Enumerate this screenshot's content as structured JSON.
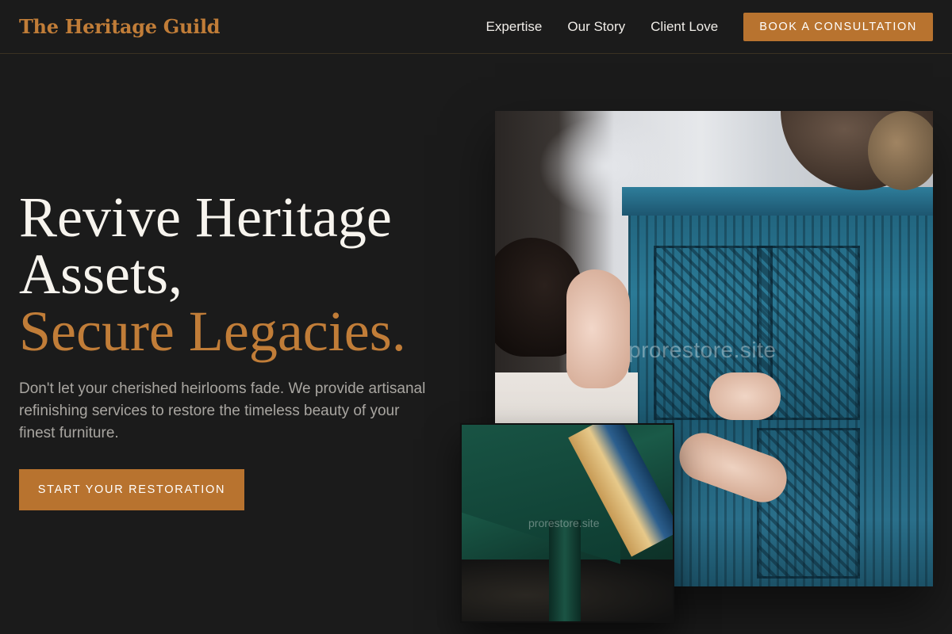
{
  "nav": {
    "brand": "The Heritage Guild",
    "links": [
      "Expertise",
      "Our Story",
      "Client Love"
    ],
    "cta": "BOOK A CONSULTATION"
  },
  "hero": {
    "title_line1": "Revive Heritage",
    "title_line2": "Assets,",
    "title_accent": "Secure Legacies.",
    "subtitle": "Don't let your cherished heirlooms fade. We provide artisanal refinishing services to restore the timeless beauty of your finest furniture.",
    "cta": "START YOUR RESTORATION"
  },
  "images": {
    "main_watermark": "prorestore.site",
    "inset_watermark": "prorestore.site"
  },
  "colors": {
    "background": "#1b1b1b",
    "accent": "#c17d38",
    "button": "#b8732f"
  }
}
